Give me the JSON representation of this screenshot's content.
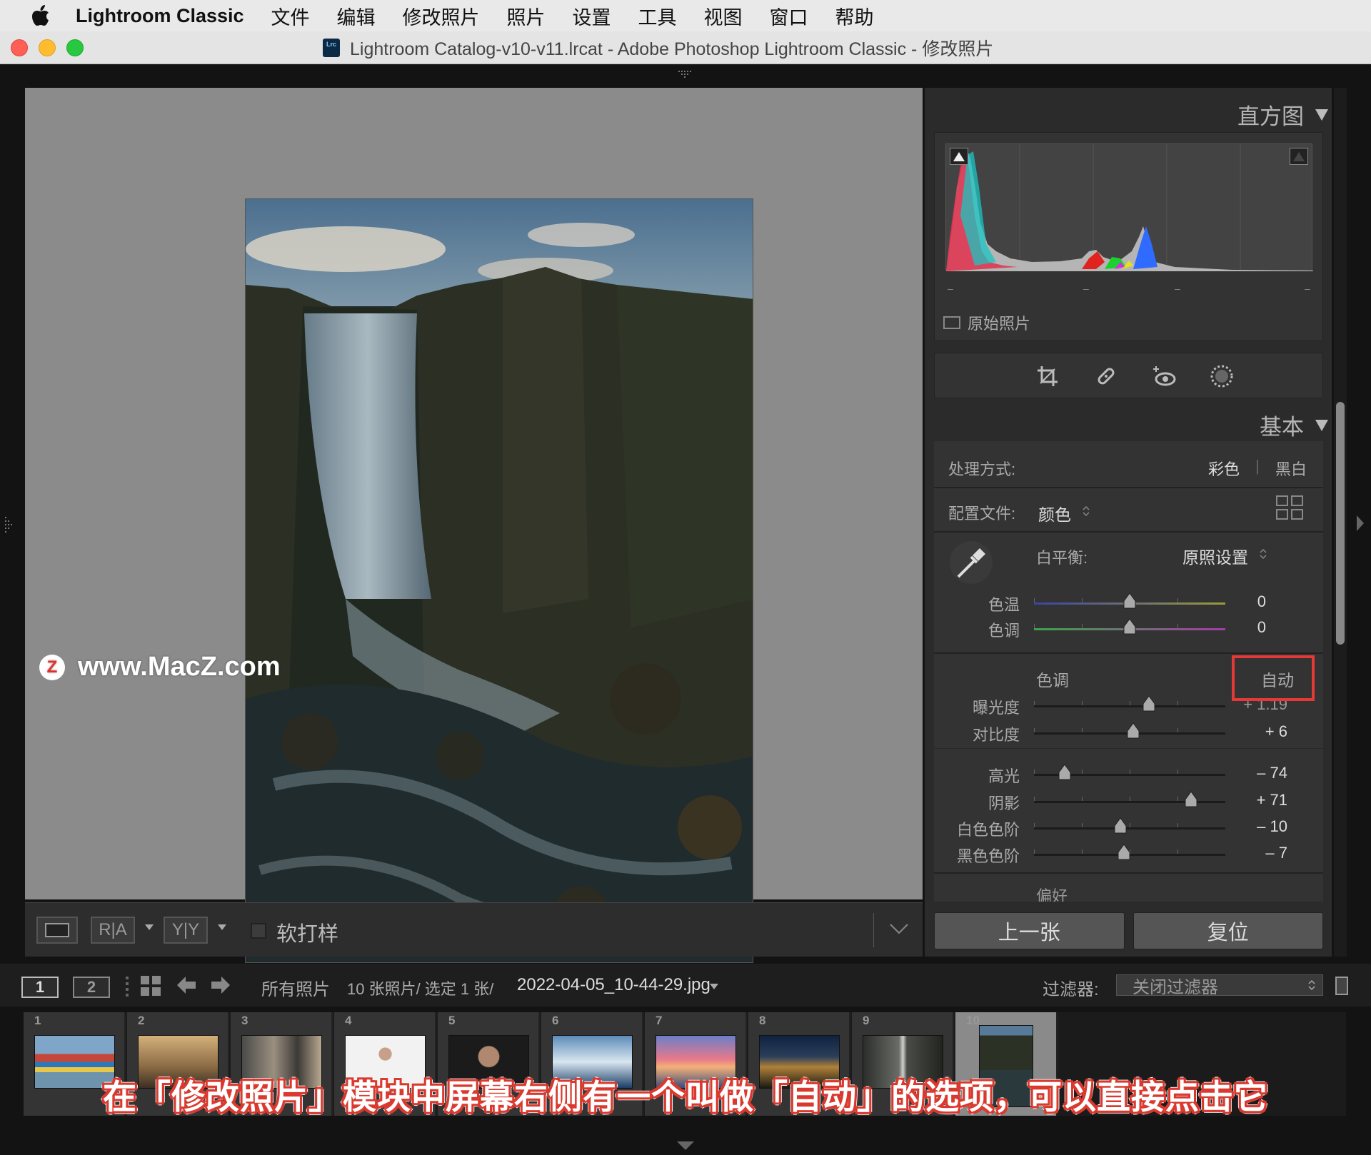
{
  "menubar": {
    "app_name": "Lightroom Classic",
    "items": [
      "文件",
      "编辑",
      "修改照片",
      "照片",
      "设置",
      "工具",
      "视图",
      "窗口",
      "帮助"
    ]
  },
  "window": {
    "icon_label": "Lrc",
    "title": "Lightroom Catalog-v10-v11.lrcat - Adobe Photoshop Lightroom Classic - 修改照片"
  },
  "watermark": {
    "logo": "Z",
    "text": "www.MacZ.com"
  },
  "toolbar": {
    "ra_label": "R|A",
    "yy_label": "Y|Y",
    "soft_proof_label": "软打样"
  },
  "histogram": {
    "header": "直方图",
    "original_photo_label": "原始照片",
    "tick_marks": [
      "–",
      "–",
      "–",
      "–"
    ]
  },
  "basic": {
    "header": "基本",
    "treatment_label": "处理方式:",
    "treatment_color": "彩色",
    "treatment_separator": "|",
    "treatment_bw": "黑白",
    "profile_label": "配置文件:",
    "profile_value": "颜色",
    "wb_label": "白平衡:",
    "wb_value": "原照设置",
    "tone_header": "色调",
    "auto_label": "自动",
    "presence_header": "偏好",
    "sliders": {
      "temp": {
        "label": "色温",
        "value": "0",
        "pos": 0.5
      },
      "tint": {
        "label": "色调",
        "value": "0",
        "pos": 0.5
      },
      "exposure": {
        "label": "曝光度",
        "value": "+ 1.19",
        "pos": 0.6
      },
      "contrast": {
        "label": "对比度",
        "value": "+ 6",
        "pos": 0.52
      },
      "highlights": {
        "label": "高光",
        "value": "– 74",
        "pos": 0.16
      },
      "shadows": {
        "label": "阴影",
        "value": "+ 71",
        "pos": 0.82
      },
      "whites": {
        "label": "白色色阶",
        "value": "– 10",
        "pos": 0.45
      },
      "blacks": {
        "label": "黑色色阶",
        "value": "– 7",
        "pos": 0.47
      }
    }
  },
  "nav": {
    "prev_label": "上一张",
    "reset_label": "复位"
  },
  "filmstrip_bar": {
    "view1": "1",
    "view2": "2",
    "source": "所有照片",
    "count": "10 张照片/ 选定 1 张/",
    "filename": "2022-04-05_10-44-29.jpg",
    "filter_label": "过滤器:",
    "filter_value": "关闭过滤器"
  },
  "filmstrip": {
    "cells": [
      "1",
      "2",
      "3",
      "4",
      "5",
      "6",
      "7",
      "8",
      "9",
      "10"
    ],
    "selected_index": 9
  },
  "caption": "在「修改照片」模块中屏幕右侧有一个叫做「自动」的选项，可以直接点击它",
  "colors": {
    "accent_red": "#e53935",
    "panel_bg": "#333333",
    "caption_outline": "#d9392e"
  }
}
